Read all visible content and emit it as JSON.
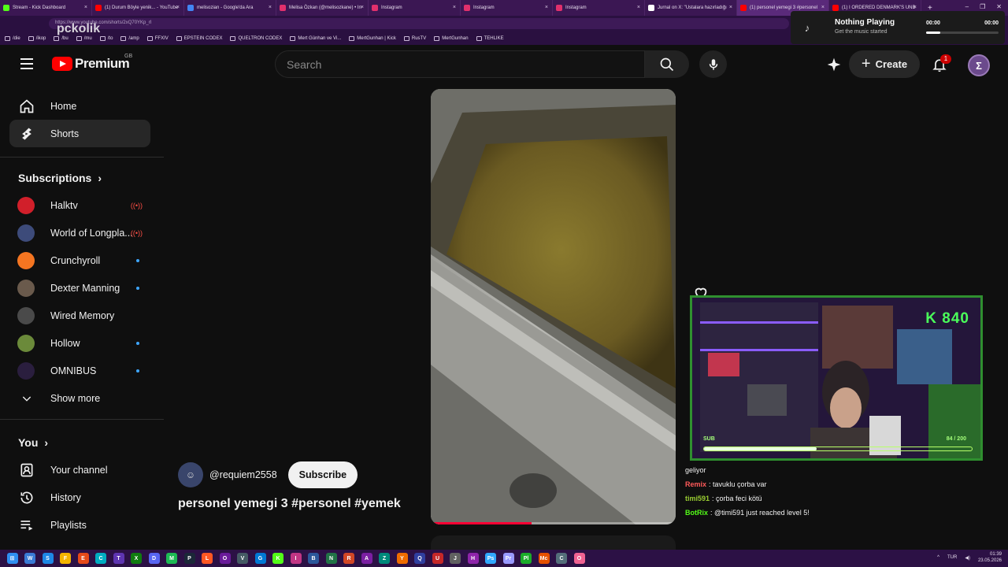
{
  "browser": {
    "tabs": [
      {
        "label": "Stream - Kick Dashboard",
        "color": "#53fc18"
      },
      {
        "label": "(1) Durum Böyle yenik... - YouTube",
        "color": "#ff0000"
      },
      {
        "label": "melisozian - Google'da Ara",
        "color": "#4285f4"
      },
      {
        "label": "Melisa Özkan (@melisozkane) • In",
        "color": "#e1306c"
      },
      {
        "label": "Instagram",
        "color": "#e1306c"
      },
      {
        "label": "Instagram",
        "color": "#e1306c"
      },
      {
        "label": "Instagram",
        "color": "#e1306c"
      },
      {
        "label": "Jurnal on X: \"Ustalara hazırladığı",
        "color": "#ffffff"
      },
      {
        "label": "(1) personel yemegi 3 #personel",
        "color": "#ff0000"
      },
      {
        "label": "(1) I ORDERED DENMARK'S UNB",
        "color": "#ff0000"
      }
    ],
    "new_tab_label": "+",
    "window_controls": [
      "–",
      "❐",
      "✕"
    ],
    "address": "https://www.youtube.com/shorts/2xQ70YKp_rI",
    "bookmarks": [
      "/die",
      "/ikop",
      "/bu",
      "/mu",
      "/to",
      "/amp",
      "FFXIV",
      "EPSTEIN CODEX",
      "QUELTRON CODEX",
      "Mert Günhan ve Vi...",
      "MertGunhan | Kick",
      "RusTV",
      "MertGunhan",
      "TEHLIKE"
    ],
    "watermark": "pckolik"
  },
  "now_playing": {
    "title": "Nothing Playing",
    "subtitle": "Get the music started",
    "time_start": "00:00",
    "time_end": "00:00"
  },
  "header": {
    "logo_text": "Premium",
    "region": "GB",
    "search_placeholder": "Search",
    "create_label": "Create",
    "notification_count": "1",
    "avatar_letter": "Σ"
  },
  "sidebar": {
    "main": [
      {
        "label": "Home",
        "icon": "home-icon",
        "active": false
      },
      {
        "label": "Shorts",
        "icon": "shorts-icon",
        "active": true
      }
    ],
    "subscriptions_title": "Subscriptions",
    "subscriptions": [
      {
        "label": "Halktv",
        "color": "#d11f2a",
        "badge": "live"
      },
      {
        "label": "World of Longpla...",
        "color": "#3d4b7a",
        "badge": "live"
      },
      {
        "label": "Crunchyroll",
        "color": "#f47521",
        "badge": "dot"
      },
      {
        "label": "Dexter Manning",
        "color": "#6a5a4c",
        "badge": "dot"
      },
      {
        "label": "Wired Memory",
        "color": "#4a4a4a",
        "badge": "none"
      },
      {
        "label": "Hollow",
        "color": "#6b8a3a",
        "badge": "dot"
      },
      {
        "label": "OMNIBUS",
        "color": "#2a1e3e",
        "badge": "dot"
      }
    ],
    "show_more": "Show more",
    "you_title": "You",
    "you_items": [
      {
        "label": "Your channel",
        "icon": "channel-icon"
      },
      {
        "label": "History",
        "icon": "history-icon"
      },
      {
        "label": "Playlists",
        "icon": "playlists-icon"
      }
    ]
  },
  "short": {
    "channel_handle": "@requiem2558",
    "subscribe_label": "Subscribe",
    "title": "personel yemegi 3 #personel #yemek",
    "progress": 0.41
  },
  "stream_overlay": {
    "brand": "K 840",
    "sub_label": "SUB",
    "sub_count": "84 / 200",
    "sub_progress": 0.42
  },
  "chat": [
    {
      "user": "",
      "text": "geliyor",
      "user_color": "#ffffff"
    },
    {
      "user": "Remix",
      "text": ": tavuklu çorba var",
      "user_color": "#ff5a5a"
    },
    {
      "user": "timi591",
      "text": ": çorba feci kötü",
      "user_color": "#9acd32"
    },
    {
      "user": "BotRix",
      "text": ": @timi591 just reached level 5!",
      "user_color": "#53fc18"
    }
  ],
  "taskbar": {
    "icons": [
      "W",
      "S",
      "F",
      "E",
      "C",
      "T",
      "X",
      "D",
      "M",
      "P",
      "L",
      "O",
      "V",
      "G",
      "K",
      "I",
      "B",
      "N",
      "R",
      "A",
      "Z",
      "Y",
      "Q",
      "U",
      "J",
      "H",
      "Ps",
      "Pr",
      "Pl",
      "Mc",
      "C",
      "O"
    ],
    "language": "TUR",
    "time": "01:39",
    "date": "23.05.2026"
  }
}
